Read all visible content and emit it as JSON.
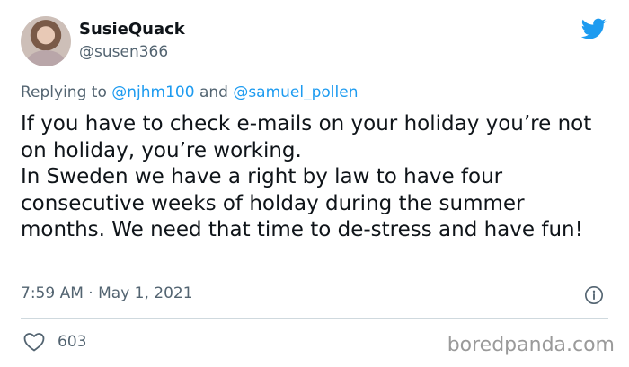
{
  "user": {
    "display_name": "SusieQuack",
    "handle": "@susen366",
    "avatar": "profile-photo"
  },
  "reply": {
    "prefix": "Replying to",
    "mention1": "@njhm100",
    "connector": "and",
    "mention2": "@samuel_pollen"
  },
  "tweet": {
    "line1": "If you have to check e-mails on your holiday you’re not on holiday, you’re working.",
    "line2": "In Sweden we have a right by law to have four consecutive weeks of holday during the summer months. We need that time to de-stress and have fun!"
  },
  "meta": {
    "time": "7:59 AM",
    "separator": "·",
    "date": "May 1, 2021"
  },
  "stats": {
    "likes": "603"
  },
  "watermark": "boredpanda.com",
  "icons": {
    "brand": "twitter-bird-icon",
    "info": "info-icon",
    "like": "heart-icon"
  },
  "colors": {
    "brand_blue": "#1d9bf0",
    "secondary_text": "#536471",
    "primary_text": "#0f1419"
  }
}
